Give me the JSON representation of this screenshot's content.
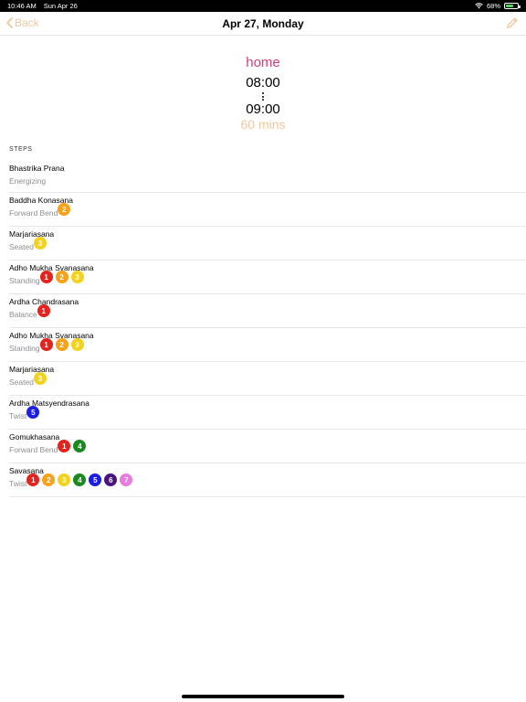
{
  "status": {
    "time": "10:46 AM",
    "date": "Sun Apr 26",
    "battery": "68%"
  },
  "nav": {
    "back_label": "Back",
    "title": "Apr 27, Monday"
  },
  "session": {
    "location": "home",
    "start": "08:00",
    "end": "09:00",
    "duration": "60 mins"
  },
  "steps_label": "STEPS",
  "level_colors": {
    "1": "#e5221c",
    "2": "#f7a21b",
    "3": "#f3d21f",
    "4": "#1a8a1f",
    "5": "#1e1ee0",
    "6": "#4a1380",
    "7": "#e87be0"
  },
  "steps": [
    {
      "name": "Bhastrika Prana",
      "category": "Energizing",
      "levels": []
    },
    {
      "name": "Baddha Konasana",
      "category": "Forward Bend",
      "levels": [
        2
      ]
    },
    {
      "name": "Marjariasana",
      "category": "Seated",
      "levels": [
        3
      ]
    },
    {
      "name": "Adho Mukha Svanasana",
      "category": "Standing",
      "levels": [
        1,
        2,
        3
      ]
    },
    {
      "name": "Ardha Chandrasana",
      "category": "Balance",
      "levels": [
        1
      ]
    },
    {
      "name": "Adho Mukha Svanasana",
      "category": "Standing",
      "levels": [
        1,
        2,
        3
      ]
    },
    {
      "name": "Marjariasana",
      "category": "Seated",
      "levels": [
        3
      ]
    },
    {
      "name": "Ardha Matsyendrasana",
      "category": "Twist",
      "levels": [
        5
      ]
    },
    {
      "name": "Gomukhasana",
      "category": "Forward Bend",
      "levels": [
        1,
        4
      ]
    },
    {
      "name": "Savasana",
      "category": "Twist",
      "levels": [
        1,
        2,
        3,
        4,
        5,
        6,
        7
      ]
    }
  ]
}
